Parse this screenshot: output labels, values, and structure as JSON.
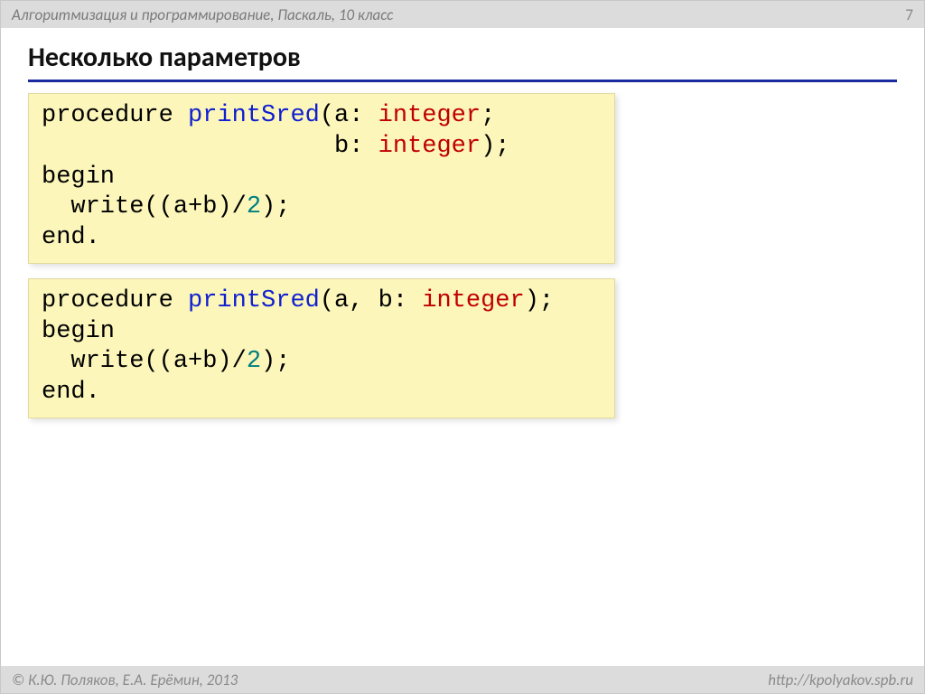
{
  "header": {
    "course": "Алгоритмизация и программирование, Паскаль, 10 класс",
    "page": "7"
  },
  "title": "Несколько параметров",
  "code1": {
    "tokens": [
      {
        "t": "procedure ",
        "c": ""
      },
      {
        "t": "printSred",
        "c": "kw-blue"
      },
      {
        "t": "(a: ",
        "c": ""
      },
      {
        "t": "integer",
        "c": "kw-red"
      },
      {
        "t": ";",
        "c": ""
      },
      {
        "t": "\n",
        "c": ""
      },
      {
        "t": "                    b: ",
        "c": ""
      },
      {
        "t": "integer",
        "c": "kw-red"
      },
      {
        "t": ");",
        "c": ""
      },
      {
        "t": "\n",
        "c": ""
      },
      {
        "t": "begin",
        "c": ""
      },
      {
        "t": "\n",
        "c": ""
      },
      {
        "t": "  write((a+b)/",
        "c": ""
      },
      {
        "t": "2",
        "c": "kw-num"
      },
      {
        "t": ");",
        "c": ""
      },
      {
        "t": "\n",
        "c": ""
      },
      {
        "t": "end.",
        "c": ""
      }
    ]
  },
  "code2": {
    "tokens": [
      {
        "t": "procedure ",
        "c": ""
      },
      {
        "t": "printSred",
        "c": "kw-blue"
      },
      {
        "t": "(a, b: ",
        "c": ""
      },
      {
        "t": "integer",
        "c": "kw-red"
      },
      {
        "t": ");",
        "c": ""
      },
      {
        "t": "\n",
        "c": ""
      },
      {
        "t": "begin",
        "c": ""
      },
      {
        "t": "\n",
        "c": ""
      },
      {
        "t": "  write((a+b)/",
        "c": ""
      },
      {
        "t": "2",
        "c": "kw-num"
      },
      {
        "t": ");",
        "c": ""
      },
      {
        "t": "\n",
        "c": ""
      },
      {
        "t": "end.",
        "c": ""
      }
    ]
  },
  "footer": {
    "copyright": "© К.Ю. Поляков, Е.А. Ерёмин, 2013",
    "url": "http://kpolyakov.spb.ru"
  }
}
